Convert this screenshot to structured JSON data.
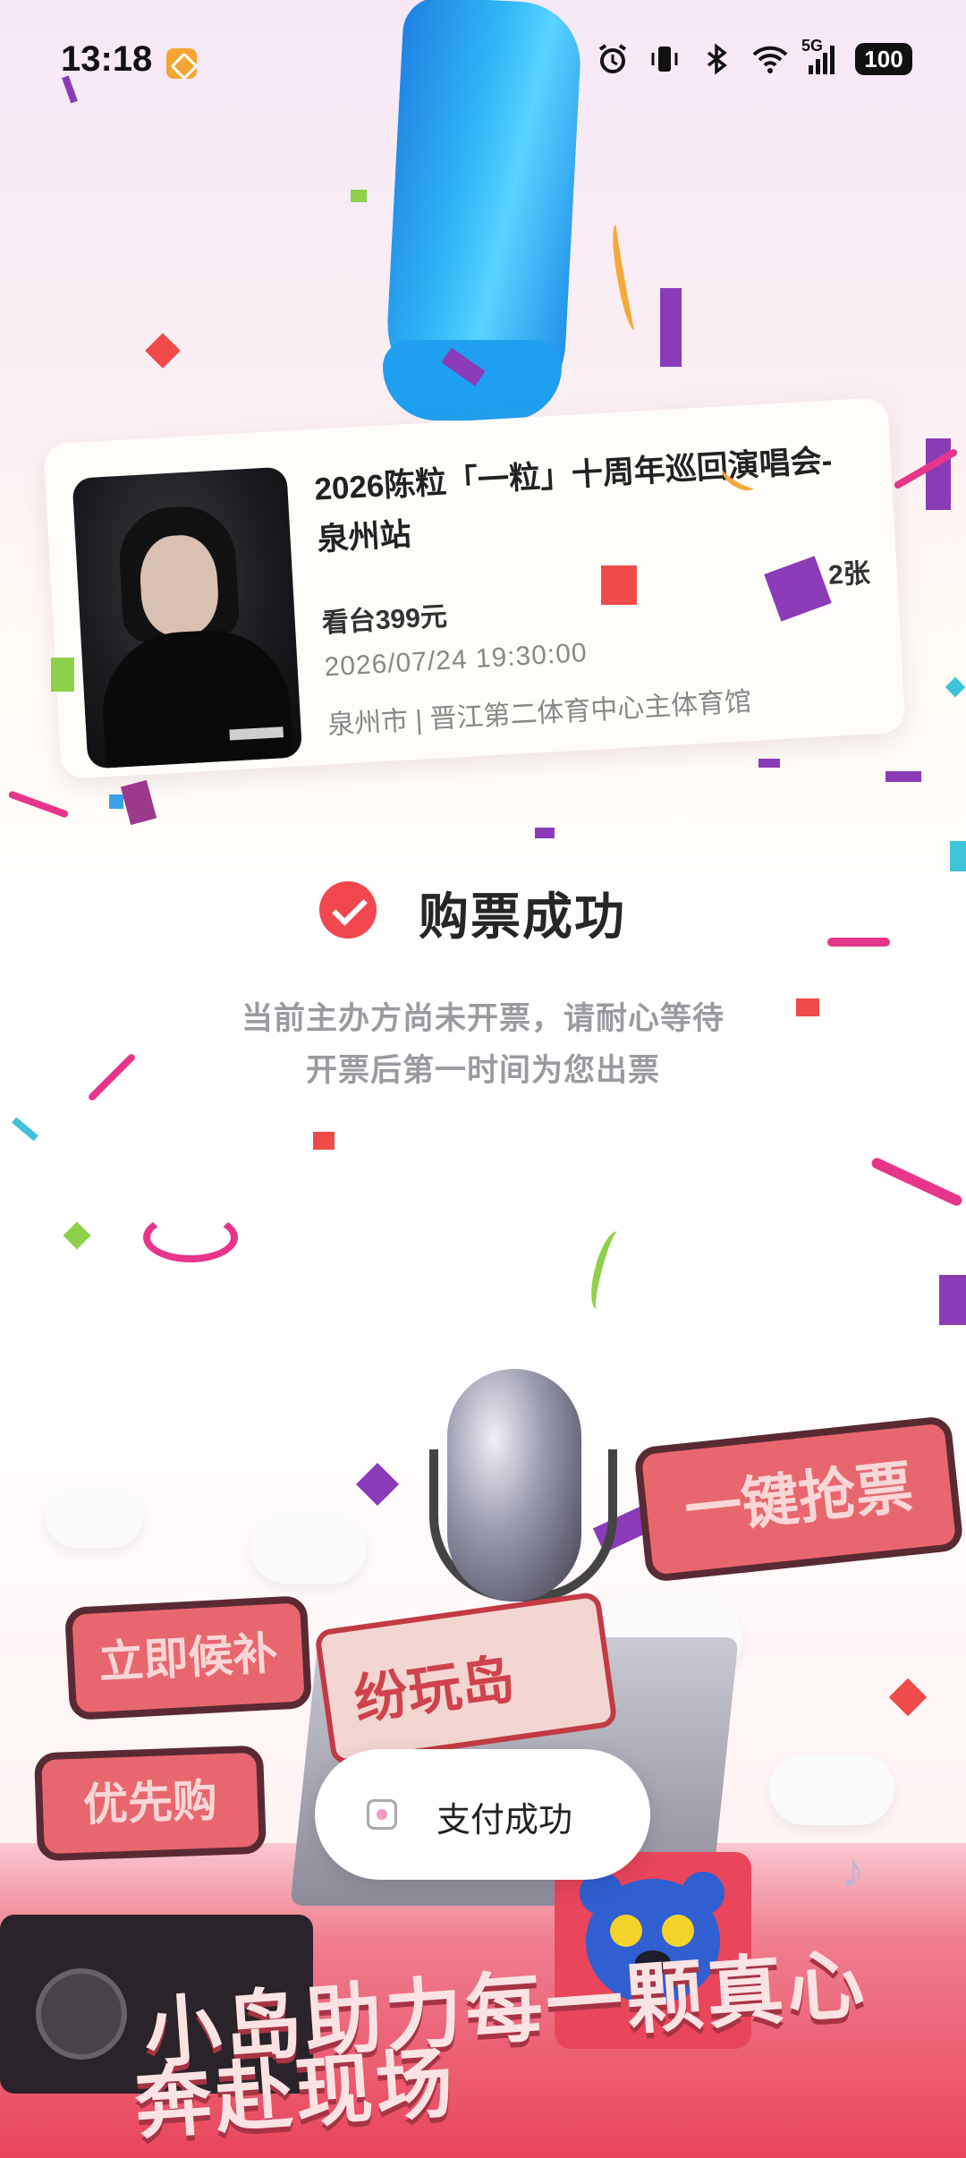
{
  "status_bar": {
    "time": "13:18",
    "network": "5G",
    "battery": "100"
  },
  "ticket": {
    "title": "2026陈粒「一粒」十周年巡回演唱会-泉州站",
    "seat": "看台399元",
    "count": "2张",
    "datetime": "2026/07/24  19:30:00",
    "venue": "泉州市 | 晋江第二体育中心主体育馆"
  },
  "success": {
    "title": "购票成功",
    "line1": "当前主办方尚未开票，请耐心等待",
    "line2": "开票后第一时间为您出票"
  },
  "promo": {
    "bubble_1": "一键抢票",
    "bubble_2": "立即候补",
    "bubble_3": "优先购",
    "sign": "纷玩岛",
    "slogan_line1": "小岛助力每一颗真心",
    "slogan_line2": "奔赴现场"
  },
  "toast": {
    "text": "支付成功"
  },
  "colors": {
    "accent": "#f2474f",
    "brand_pink": "#e9455b",
    "hand_blue": "#2fb6f5"
  }
}
